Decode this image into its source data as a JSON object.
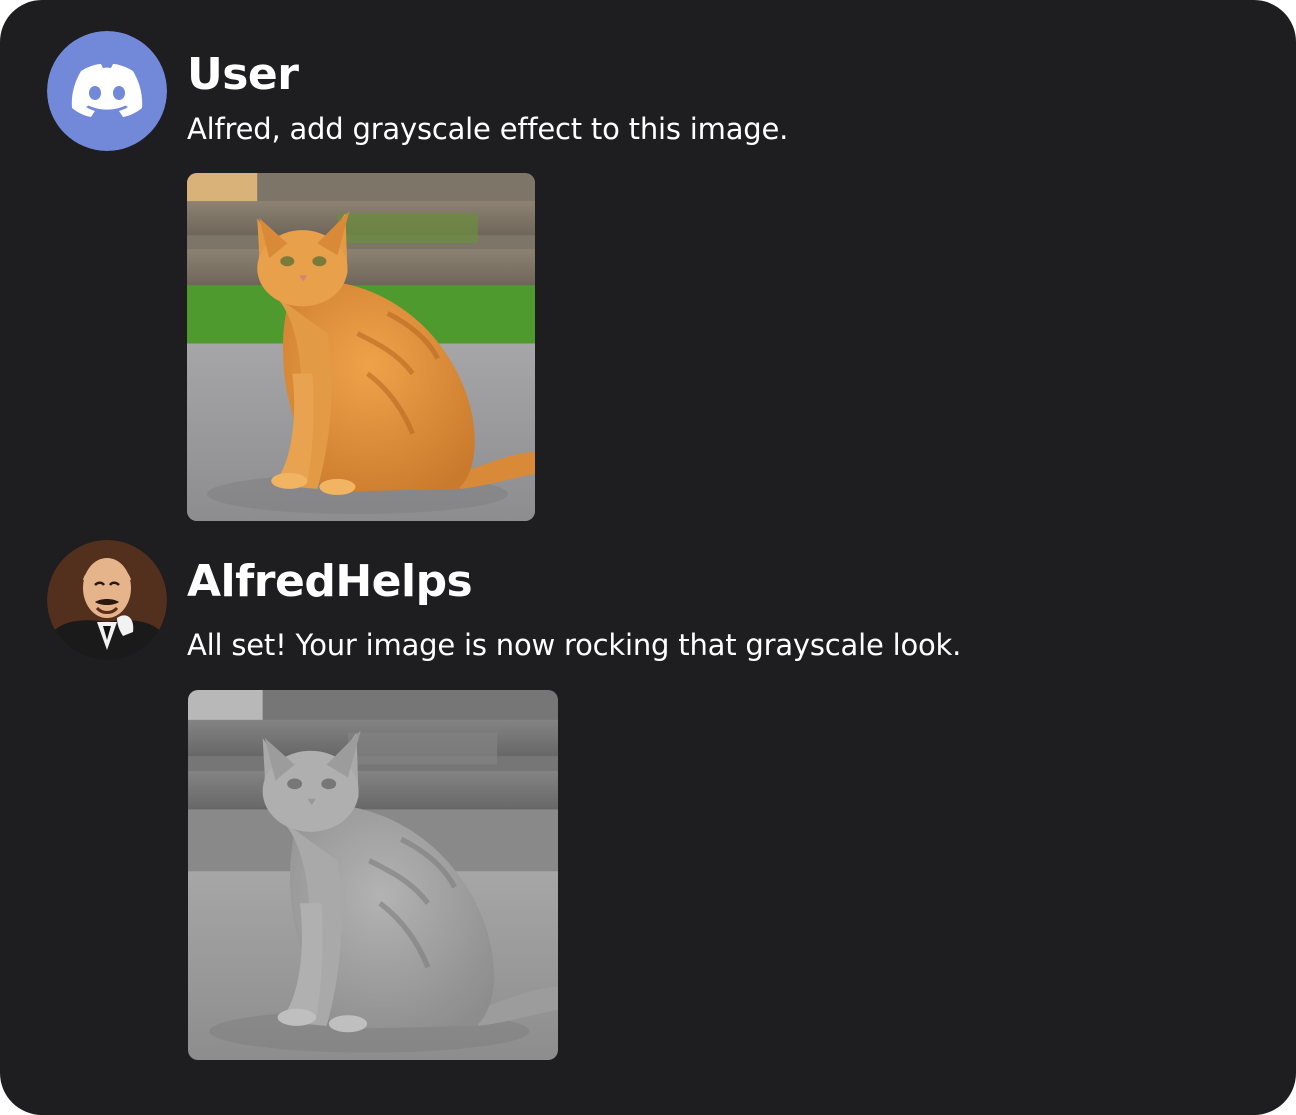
{
  "messages": [
    {
      "author": "User",
      "avatar_icon": "discord-logo-icon",
      "text": "Alfred, add grayscale effect to this image.",
      "attachment": {
        "subject": "orange-tabby-cat-photo",
        "filter": "none"
      }
    },
    {
      "author": "AlfredHelps",
      "avatar_icon": "cartoon-butler-avatar",
      "text": "All set! Your image is now rocking that grayscale look.",
      "attachment": {
        "subject": "grayscale-tabby-cat-photo",
        "filter": "grayscale"
      }
    }
  ],
  "colors": {
    "background": "#1e1e20",
    "discord_blurple": "#7289da",
    "text": "#ffffff"
  }
}
